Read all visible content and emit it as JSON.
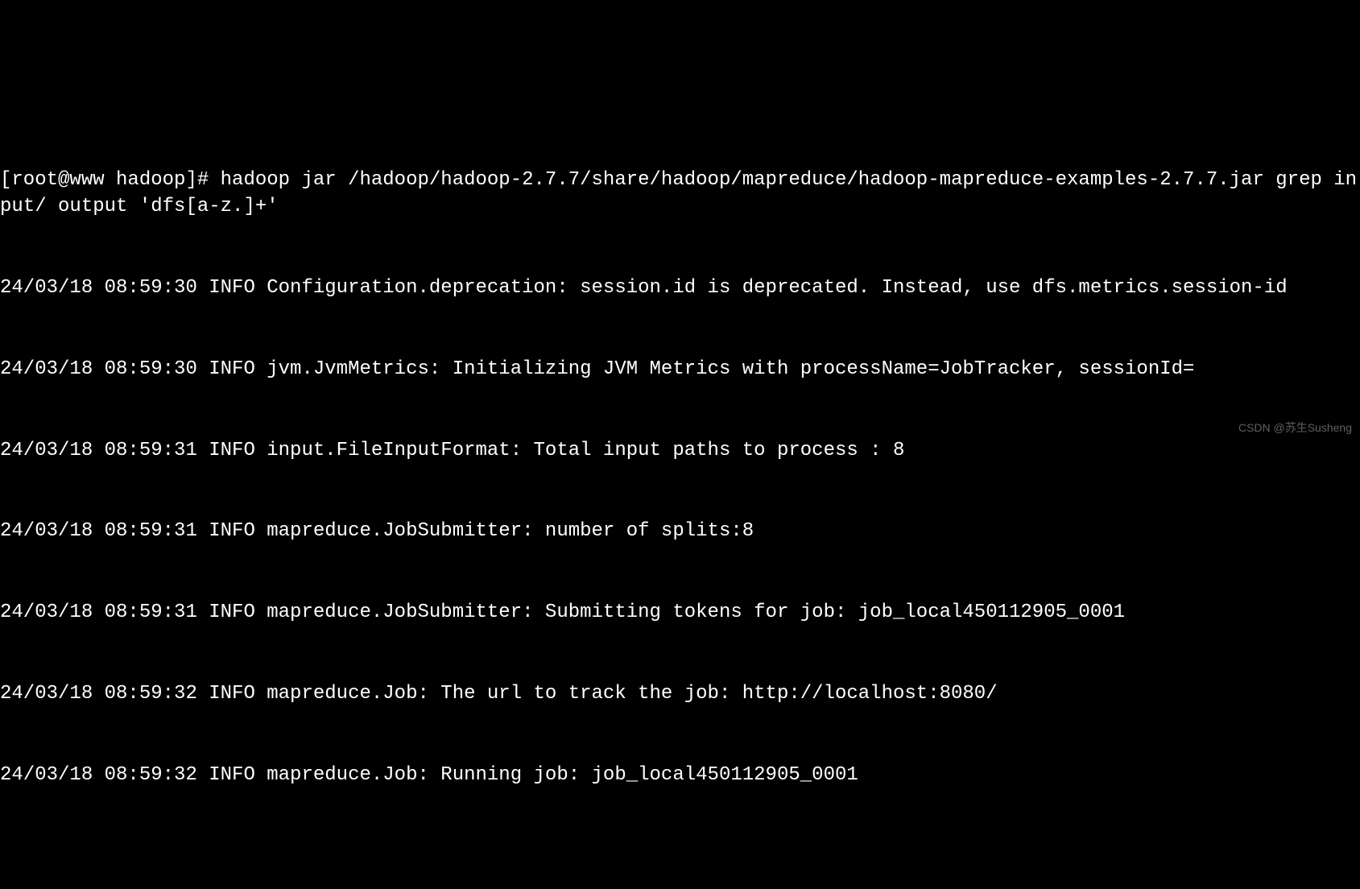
{
  "terminal": {
    "lines": [
      "[root@www hadoop]# hadoop jar /hadoop/hadoop-2.7.7/share/hadoop/mapreduce/hadoop-mapreduce-examples-2.7.7.jar grep input/ output 'dfs[a-z.]+'",
      "24/03/18 08:59:30 INFO Configuration.deprecation: session.id is deprecated. Instead, use dfs.metrics.session-id",
      "24/03/18 08:59:30 INFO jvm.JvmMetrics: Initializing JVM Metrics with processName=JobTracker, sessionId=",
      "24/03/18 08:59:31 INFO input.FileInputFormat: Total input paths to process : 8",
      "24/03/18 08:59:31 INFO mapreduce.JobSubmitter: number of splits:8",
      "24/03/18 08:59:31 INFO mapreduce.JobSubmitter: Submitting tokens for job: job_local450112905_0001",
      "24/03/18 08:59:32 INFO mapreduce.Job: The url to track the job: http://localhost:8080/",
      "24/03/18 08:59:32 INFO mapreduce.Job: Running job: job_local450112905_0001"
    ]
  },
  "watermark": "CSDN @苏生Susheng"
}
